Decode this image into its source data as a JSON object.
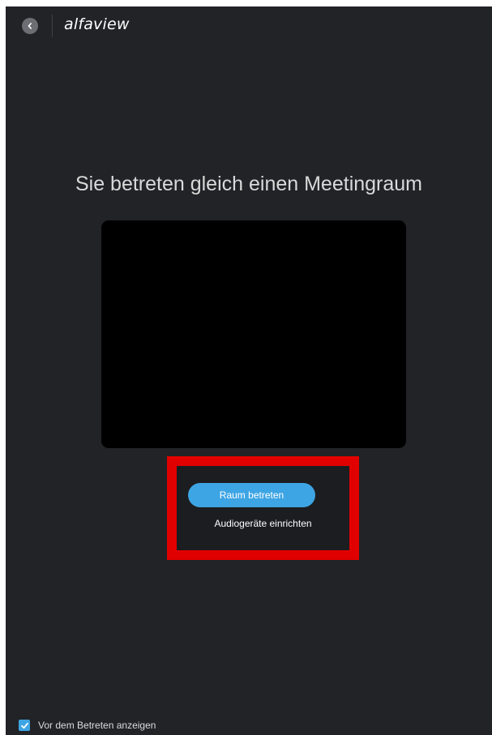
{
  "app": {
    "logo": "alfaview",
    "back_icon": "chevron-left-icon"
  },
  "main": {
    "headline": "Sie betreten gleich einen Meetingraum",
    "join_button": "Raum betreten",
    "audio_setup_link": "Audiogeräte einrichten"
  },
  "footer": {
    "show_before_join_label": "Vor dem Betreten anzeigen",
    "show_before_join_checked": true
  },
  "colors": {
    "background": "#212327",
    "accent": "#3ea5e4",
    "highlight_border": "#e00000"
  }
}
